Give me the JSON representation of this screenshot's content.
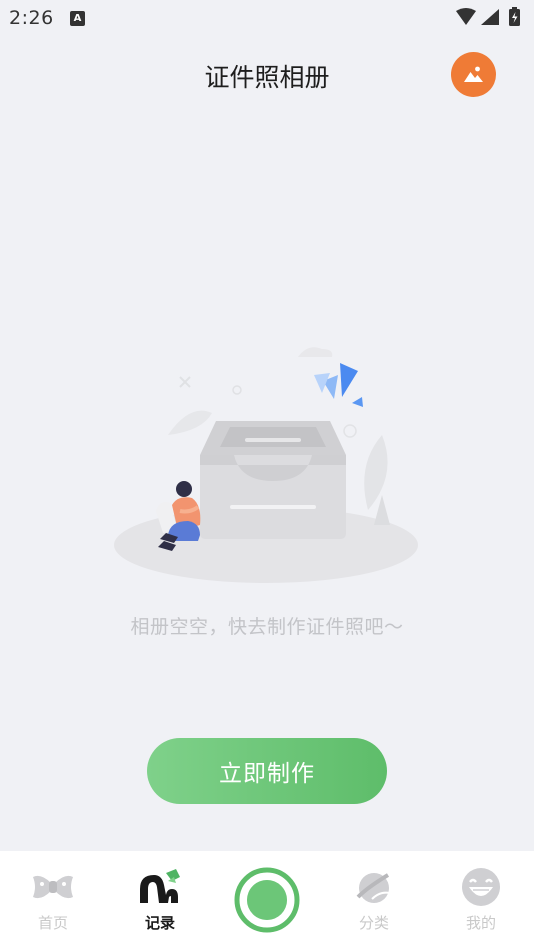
{
  "status_bar": {
    "time": "2:26",
    "notification_icon": "a-badge-icon",
    "icons": [
      "wifi-icon",
      "signal-icon",
      "battery-icon"
    ]
  },
  "header": {
    "title": "证件照相册",
    "action_icon": "gallery-icon"
  },
  "empty_state": {
    "illustration": "empty-inbox-illustration",
    "message": "相册空空，快去制作证件照吧～"
  },
  "primary_action": {
    "label": "立即制作"
  },
  "bottom_nav": {
    "items": [
      {
        "label": "首页",
        "icon": "bow-tie-icon",
        "active": false
      },
      {
        "label": "记录",
        "icon": "record-icon",
        "active": true
      },
      {
        "label": "",
        "icon": "camera-shutter-icon",
        "active": false
      },
      {
        "label": "分类",
        "icon": "category-icon",
        "active": false
      },
      {
        "label": "我的",
        "icon": "face-icon",
        "active": false
      }
    ]
  },
  "colors": {
    "background": "#f0f1f5",
    "accent_green": "#5ebd6a",
    "accent_orange": "#ef7b36",
    "inactive_nav": "#c9c9c9"
  }
}
